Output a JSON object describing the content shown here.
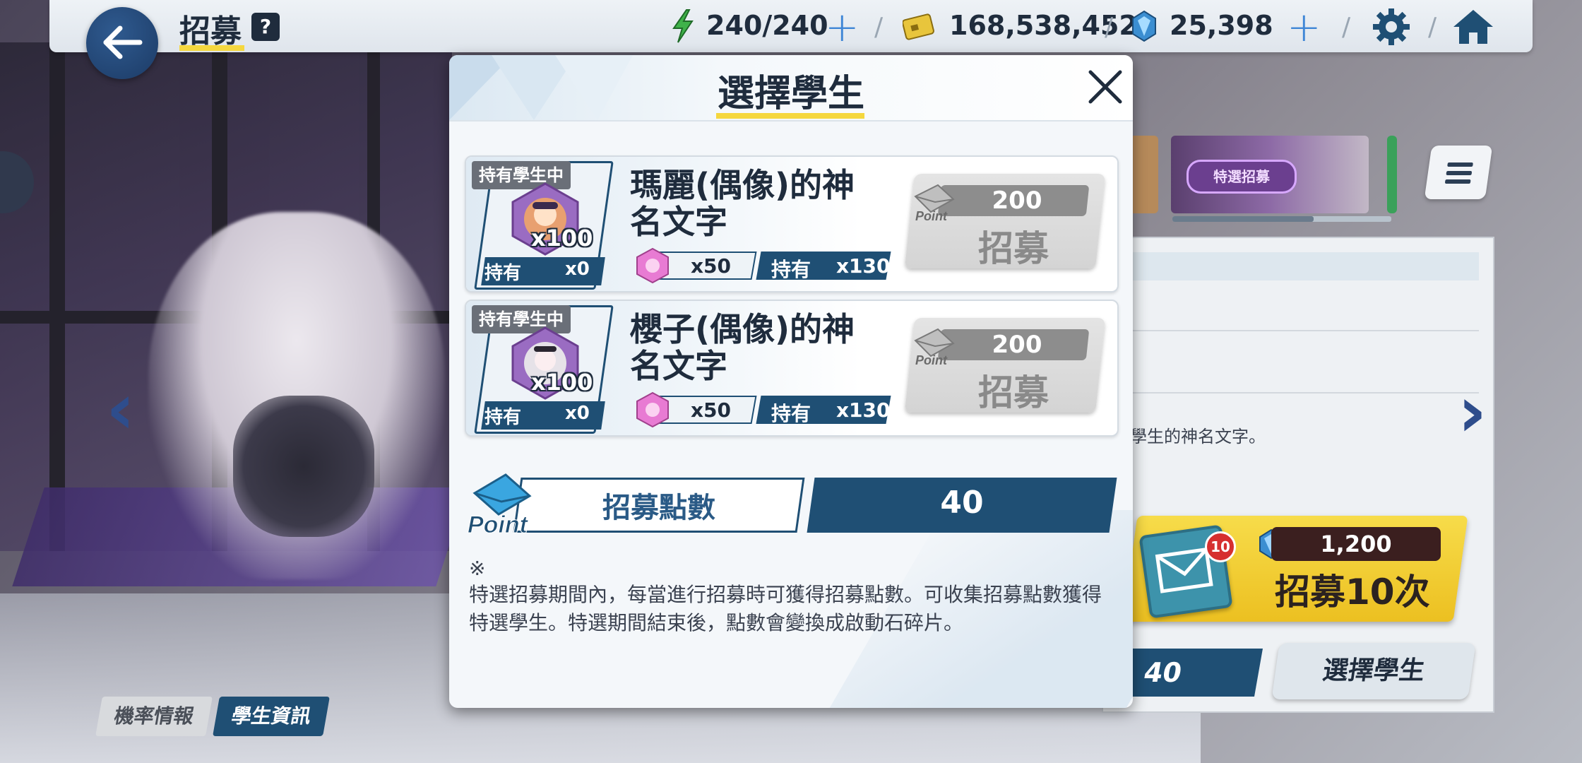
{
  "topbar": {
    "title": "招募",
    "help": "?",
    "stamina": "240/240",
    "credits": "168,538,452",
    "gems": "25,398"
  },
  "background": {
    "banner_label": "特選招募",
    "description_fragment": "學生的神名文字。",
    "ten_pull_price": "1,200",
    "ten_pull_label": "招募10次",
    "ten_pull_badge": "10",
    "points_value": "40",
    "select_student_label": "選擇學生",
    "tab_rates": "機率情報",
    "tab_student_info": "學生資訊"
  },
  "modal": {
    "title": "選擇學生",
    "students": [
      {
        "owned_tag": "持有學生中",
        "portrait_count": "x100",
        "owned_label": "持有",
        "owned_value": "x0",
        "name": "瑪麗(偶像)的神名文字",
        "item_cost": "x50",
        "item_owned_label": "持有",
        "item_owned_value": "x130",
        "point_cost": "200",
        "recruit_label": "招募",
        "portrait_color": "#e8a070"
      },
      {
        "owned_tag": "持有學生中",
        "portrait_count": "x100",
        "owned_label": "持有",
        "owned_value": "x0",
        "name": "櫻子(偶像)的神名文字",
        "item_cost": "x50",
        "item_owned_label": "持有",
        "item_owned_value": "x130",
        "point_cost": "200",
        "recruit_label": "招募",
        "portrait_color": "#e6e2e8"
      }
    ],
    "points": {
      "label": "招募點數",
      "value": "40",
      "icon_text": "Point"
    },
    "note_mark": "※",
    "note_text": "特選招募期間內，每當進行招募時可獲得招募點數。可收集招募點數獲得特選學生。特選期間結束後，點數會變換成啟動石碎片。"
  },
  "colors": {
    "navy": "#1f4f74",
    "accent_yellow": "#f5d73e",
    "disabled_gray": "#d4d4d4"
  }
}
